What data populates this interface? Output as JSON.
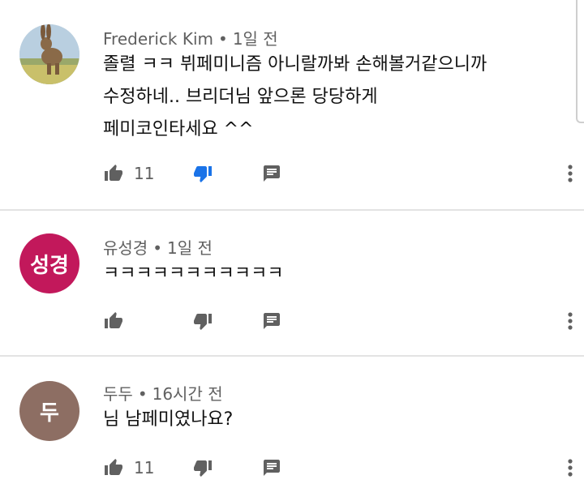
{
  "comments": [
    {
      "author": "Frederick Kim",
      "time": "1일 전",
      "lines": [
        "졸렬 ㅋㅋ 뷔페미니즘 아니랄까봐 손해볼거같으니까",
        "수정하네.. 브리더님 앞으론 당당하게",
        "페미코인타세요 ^^"
      ],
      "likes": "11",
      "avatar_icon": "rabbit-photo"
    },
    {
      "author": "유성경",
      "time": "1일 전",
      "lines": [
        "ㅋㅋㅋㅋㅋㅋㅋㅋㅋㅋㅋ"
      ],
      "likes": "",
      "avatar_text": "성경",
      "avatar_color": "#c2185b"
    },
    {
      "author": "두두",
      "time": "16시간 전",
      "lines": [
        "님 남페미였나요?"
      ],
      "likes": "11",
      "avatar_text": "두",
      "avatar_color": "#8d6e63"
    }
  ],
  "meta_separator": "•",
  "colors": {
    "dislike_active": "#1a73e8",
    "icon": "#606060",
    "text": "#111111",
    "meta": "#606060"
  }
}
